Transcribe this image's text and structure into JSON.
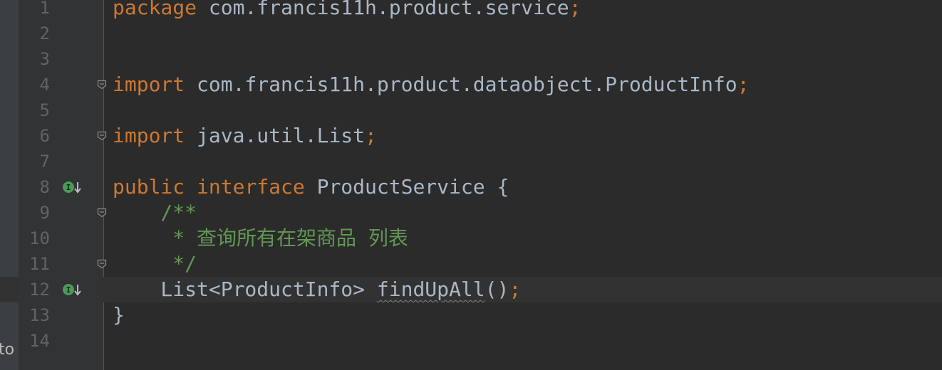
{
  "left_panel": {
    "clipped_text": "to"
  },
  "editor": {
    "lines": [
      {
        "n": "1",
        "parts": [
          {
            "t": "package",
            "c": "kw"
          },
          {
            "t": " com.francis11h.product.service",
            "c": ""
          },
          {
            "t": ";",
            "c": "kw"
          }
        ]
      },
      {
        "n": "2",
        "parts": []
      },
      {
        "n": "3",
        "parts": []
      },
      {
        "n": "4",
        "parts": [
          {
            "t": "import",
            "c": "kw"
          },
          {
            "t": " com.francis11h.product.dataobject.ProductInfo",
            "c": ""
          },
          {
            "t": ";",
            "c": "kw"
          }
        ]
      },
      {
        "n": "5",
        "parts": []
      },
      {
        "n": "6",
        "parts": [
          {
            "t": "import",
            "c": "kw"
          },
          {
            "t": " java.util.List",
            "c": ""
          },
          {
            "t": ";",
            "c": "kw"
          }
        ]
      },
      {
        "n": "7",
        "parts": []
      },
      {
        "n": "8",
        "parts": [
          {
            "t": "public",
            "c": "kw"
          },
          {
            "t": " ",
            "c": ""
          },
          {
            "t": "interface",
            "c": "kw"
          },
          {
            "t": " ProductService {",
            "c": ""
          }
        ]
      },
      {
        "n": "9",
        "parts": [
          {
            "t": "    /**",
            "c": "cm"
          }
        ]
      },
      {
        "n": "10",
        "parts": [
          {
            "t": "     * 查询所有在架商品 列表",
            "c": "cm"
          }
        ]
      },
      {
        "n": "11",
        "parts": [
          {
            "t": "     */",
            "c": "cm"
          }
        ]
      },
      {
        "n": "12",
        "parts": [
          {
            "t": "    List<ProductInfo> ",
            "c": ""
          },
          {
            "t": "findUpAll",
            "c": "fn-under"
          },
          {
            "t": "()",
            "c": ""
          },
          {
            "t": ";",
            "c": "kw"
          }
        ]
      },
      {
        "n": "13",
        "parts": [
          {
            "t": "}",
            "c": ""
          }
        ]
      },
      {
        "n": "14",
        "parts": []
      }
    ],
    "current_line": "12",
    "fold_lines": [
      "4",
      "6",
      "9",
      "11"
    ],
    "implemented_lines": [
      "8",
      "12"
    ],
    "implemented_icon": "interface-implemented-icon",
    "fold_icon": "fold-marker-icon"
  }
}
